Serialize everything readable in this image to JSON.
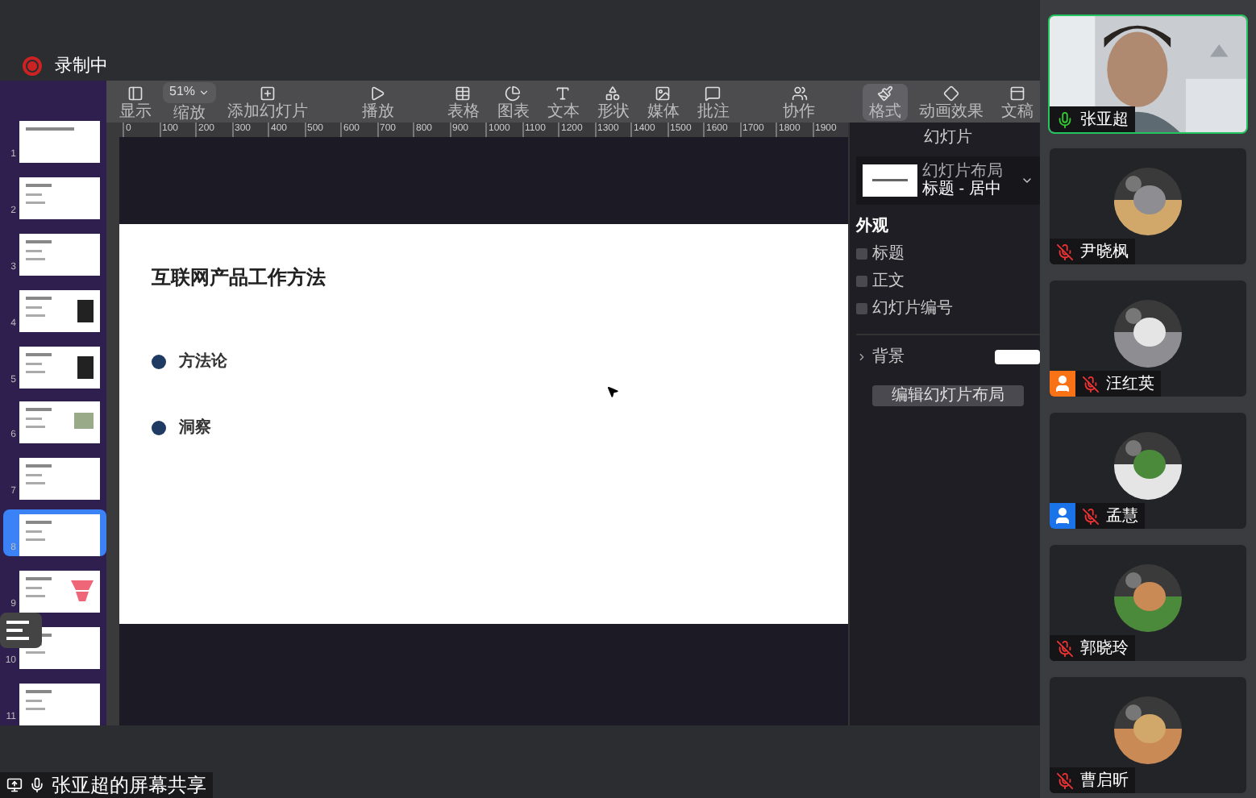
{
  "recording": {
    "label": "录制中"
  },
  "toolbar": {
    "groups": [
      [
        {
          "kind": "button",
          "label": "显示",
          "selected": false
        },
        {
          "kind": "zoom",
          "label": "缩放",
          "value": "51%"
        },
        {
          "kind": "button",
          "label": "添加幻灯片",
          "selected": false
        }
      ],
      [
        {
          "kind": "button",
          "label": "播放",
          "selected": false
        }
      ],
      [
        {
          "kind": "button",
          "label": "表格",
          "selected": false
        },
        {
          "kind": "button",
          "label": "图表",
          "selected": false
        },
        {
          "kind": "button",
          "label": "文本",
          "selected": false
        },
        {
          "kind": "button",
          "label": "形状",
          "selected": false
        },
        {
          "kind": "button",
          "label": "媒体",
          "selected": false
        },
        {
          "kind": "button",
          "label": "批注",
          "selected": false
        }
      ],
      [
        {
          "kind": "button",
          "label": "协作",
          "selected": false
        }
      ],
      [
        {
          "kind": "button",
          "label": "格式",
          "selected": true
        },
        {
          "kind": "button",
          "label": "动画效果",
          "selected": false
        },
        {
          "kind": "button",
          "label": "文稿",
          "selected": false
        }
      ]
    ]
  },
  "ruler": {
    "ticks": [
      "0",
      "100",
      "200",
      "300",
      "400",
      "500",
      "600",
      "700",
      "800",
      "900",
      "1000",
      "1100",
      "1200",
      "1300",
      "1400",
      "1500",
      "1600",
      "1700",
      "1800",
      "1900"
    ]
  },
  "slides": [
    {
      "number": "1",
      "selected": false
    },
    {
      "number": "2",
      "selected": false
    },
    {
      "number": "3",
      "selected": false
    },
    {
      "number": "4",
      "selected": false
    },
    {
      "number": "5",
      "selected": false
    },
    {
      "number": "6",
      "selected": false
    },
    {
      "number": "7",
      "selected": false
    },
    {
      "number": "8",
      "selected": true
    },
    {
      "number": "9",
      "selected": false
    },
    {
      "number": "10",
      "selected": false
    },
    {
      "number": "11",
      "selected": false
    }
  ],
  "slide": {
    "title": "互联网产品工作方法",
    "bullets": [
      "方法论",
      "洞察"
    ]
  },
  "inspector": {
    "tab": "幻灯片",
    "layout_label": "幻灯片布局",
    "layout_value": "标题 - 居中",
    "appearance": "外观",
    "checkboxes": [
      {
        "label": "标题",
        "checked": false
      },
      {
        "label": "正文",
        "checked": false
      },
      {
        "label": "幻灯片编号",
        "checked": false
      }
    ],
    "background": "背景",
    "edit_button": "编辑幻灯片布局"
  },
  "share_label": "张亚超的屏幕共享",
  "participants": [
    {
      "name": "张亚超",
      "muted": false,
      "video": true
    },
    {
      "name": "尹晓枫",
      "muted": true,
      "video": false
    },
    {
      "name": "汪红英",
      "muted": true,
      "video": false,
      "color": "#f97316"
    },
    {
      "name": "孟慧",
      "muted": true,
      "video": false,
      "color": "#1a73e8"
    },
    {
      "name": "郭晓玲",
      "muted": true,
      "video": false
    },
    {
      "name": "曹启昕",
      "muted": true,
      "video": false
    }
  ]
}
